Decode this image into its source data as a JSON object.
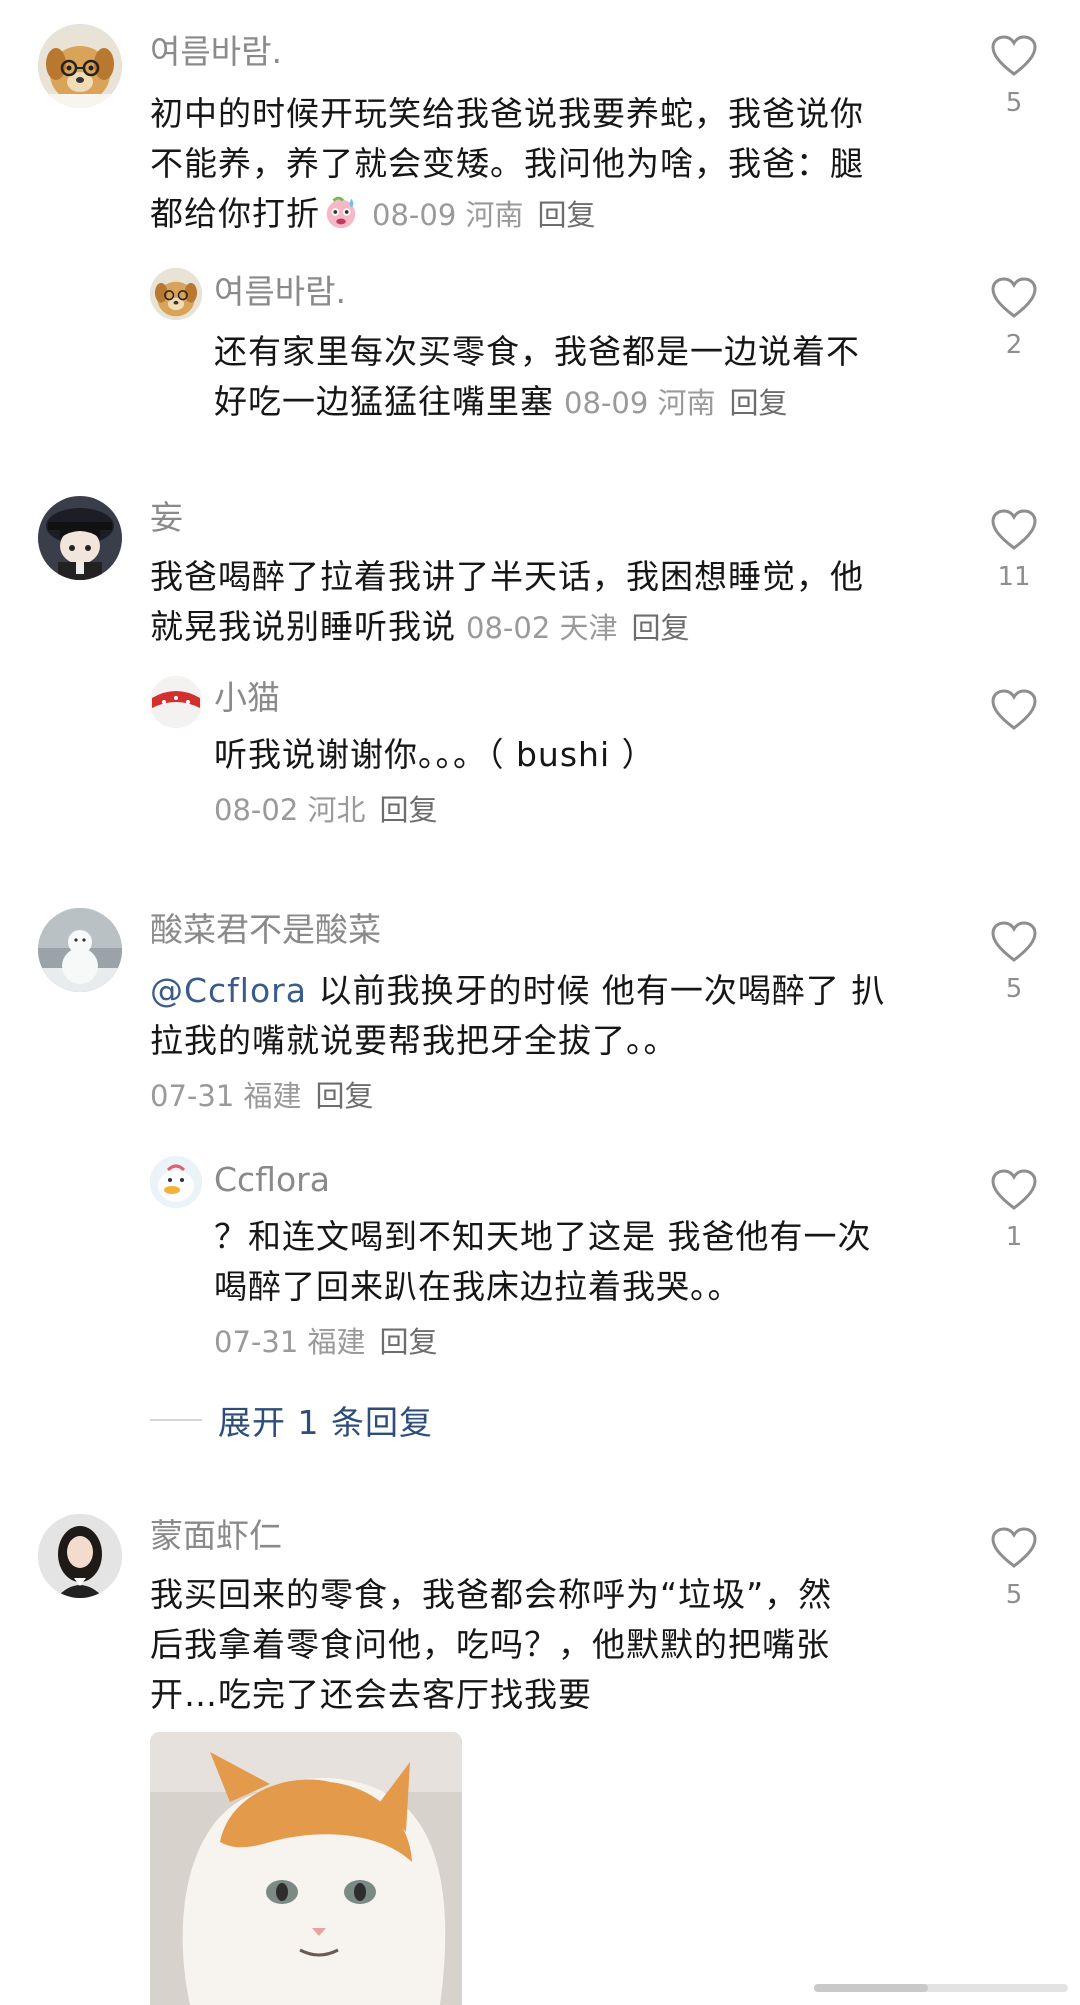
{
  "comments": [
    {
      "username": "여름바람.",
      "lines": [
        "初中的时候开玩笑给我爸说我要养蛇，我爸说你",
        "不能养，养了就会变矮。我问他为啥，我爸：腿",
        "都给你打折"
      ],
      "date": "08-09",
      "location": "河南",
      "reply_label": "回复",
      "likes": "5",
      "avatar_icon": "dog-with-glasses-avatar",
      "replies": [
        {
          "username": "여름바람.",
          "lines": [
            "还有家里每次买零食，我爸都是一边说着不",
            "好吃一边猛猛往嘴里塞"
          ],
          "date": "08-09",
          "location": "河南",
          "reply_label": "回复",
          "likes": "2"
        }
      ]
    },
    {
      "username": "妄",
      "lines": [
        "我爸喝醉了拉着我讲了半天话，我困想睡觉，他",
        "就晃我说别睡听我说"
      ],
      "date": "08-02",
      "location": "天津",
      "reply_label": "回复",
      "likes": "11",
      "avatar_icon": "anime-character-avatar",
      "replies": [
        {
          "username": "小猫",
          "lines": [
            "听我说谢谢你。。。（ bushi ）"
          ],
          "date": "08-02",
          "location": "河北",
          "reply_label": "回复",
          "likes": ""
        }
      ]
    },
    {
      "username": "酸菜君不是酸菜",
      "mention": "@Ccflora",
      "lines": [
        " 以前我换牙的时候 他有一次喝醉了 扒",
        "拉我的嘴就说要帮我把牙全拔了。。"
      ],
      "date": "07-31",
      "location": "福建",
      "reply_label": "回复",
      "likes": "5",
      "avatar_icon": "snowman-avatar",
      "replies": [
        {
          "username": "Ccflora",
          "lines": [
            "？和连文喝到不知天地了这是 我爸他有一次",
            "喝醉了回来趴在我床边拉着我哭。。"
          ],
          "date": "07-31",
          "location": "福建",
          "reply_label": "回复",
          "likes": "1"
        }
      ],
      "expand_label": "展开 1 条回复"
    },
    {
      "username": "蒙面虾仁",
      "lines": [
        "我买回来的零食，我爸都会称呼为“垃圾”，然",
        "后我拿着零食问他，吃吗？，他默默的把嘴张",
        "开…吃完了还会去客厅找我要"
      ],
      "likes": "5",
      "avatar_icon": "girl-photo-avatar",
      "image_icon": "orange-white-cat-photo"
    }
  ],
  "scroll_progress": 0.45
}
